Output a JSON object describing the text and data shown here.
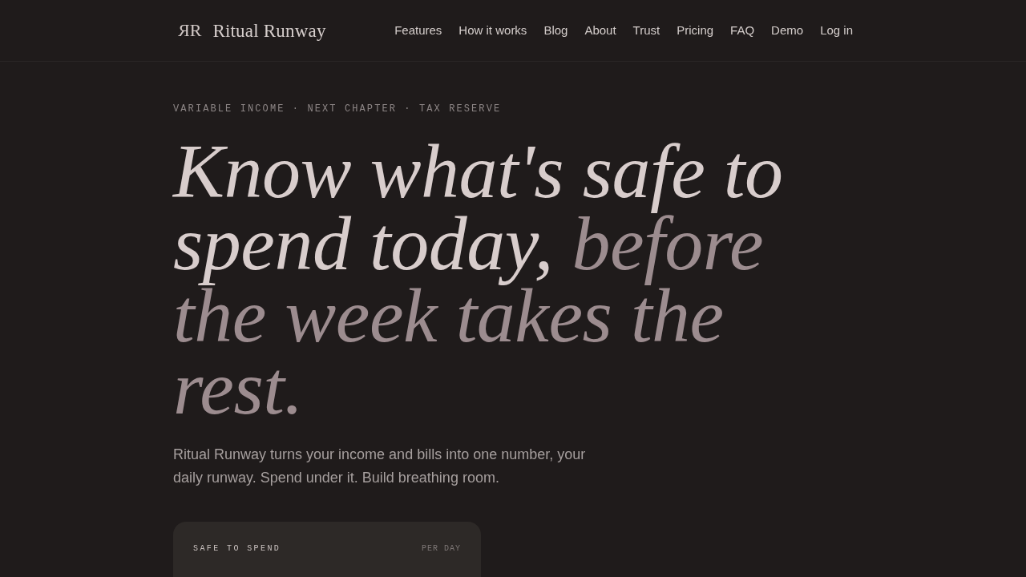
{
  "header": {
    "logo": {
      "mark": "RR",
      "name": "Ritual Runway"
    },
    "nav": [
      {
        "label": "Features"
      },
      {
        "label": "How it works"
      },
      {
        "label": "Blog"
      },
      {
        "label": "About"
      },
      {
        "label": "Trust"
      },
      {
        "label": "Pricing"
      },
      {
        "label": "FAQ"
      },
      {
        "label": "Demo"
      },
      {
        "label": "Log in"
      }
    ]
  },
  "hero": {
    "eyebrow": "VARIABLE INCOME · NEXT CHAPTER · TAX RESERVE",
    "headline": {
      "lead": "Know what's safe to spend today,",
      "muted": "before the week takes the rest."
    },
    "description": "Ritual Runway turns your income and bills into one number, your daily runway. Spend under it. Build breathing room.",
    "card": {
      "label": "SAFE TO SPEND",
      "period": "PER DAY"
    }
  }
}
